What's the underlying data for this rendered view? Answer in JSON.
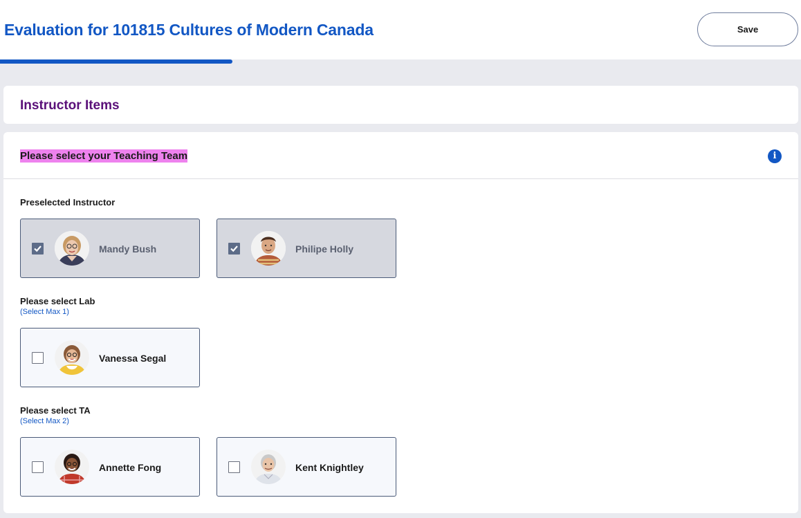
{
  "header": {
    "title": "Evaluation for 101815 Cultures of Modern Canada",
    "save_label": "Save",
    "progress_fraction": 0.29,
    "accent_color": "#1257c4"
  },
  "section": {
    "title": "Instructor Items"
  },
  "question": {
    "title": "Please select your Teaching Team",
    "info_icon": "info-icon",
    "groups": [
      {
        "label": "Preselected Instructor",
        "hint": "",
        "people": [
          {
            "name": "Mandy Bush",
            "selected": true
          },
          {
            "name": "Philipe Holly",
            "selected": true
          }
        ]
      },
      {
        "label": "Please select Lab",
        "hint": "(Select Max 1)",
        "people": [
          {
            "name": "Vanessa Segal",
            "selected": false
          }
        ]
      },
      {
        "label": "Please select TA",
        "hint": "(Select Max 2)",
        "people": [
          {
            "name": "Annette Fong",
            "selected": false
          },
          {
            "name": "Kent Knightley",
            "selected": false
          }
        ]
      }
    ]
  }
}
